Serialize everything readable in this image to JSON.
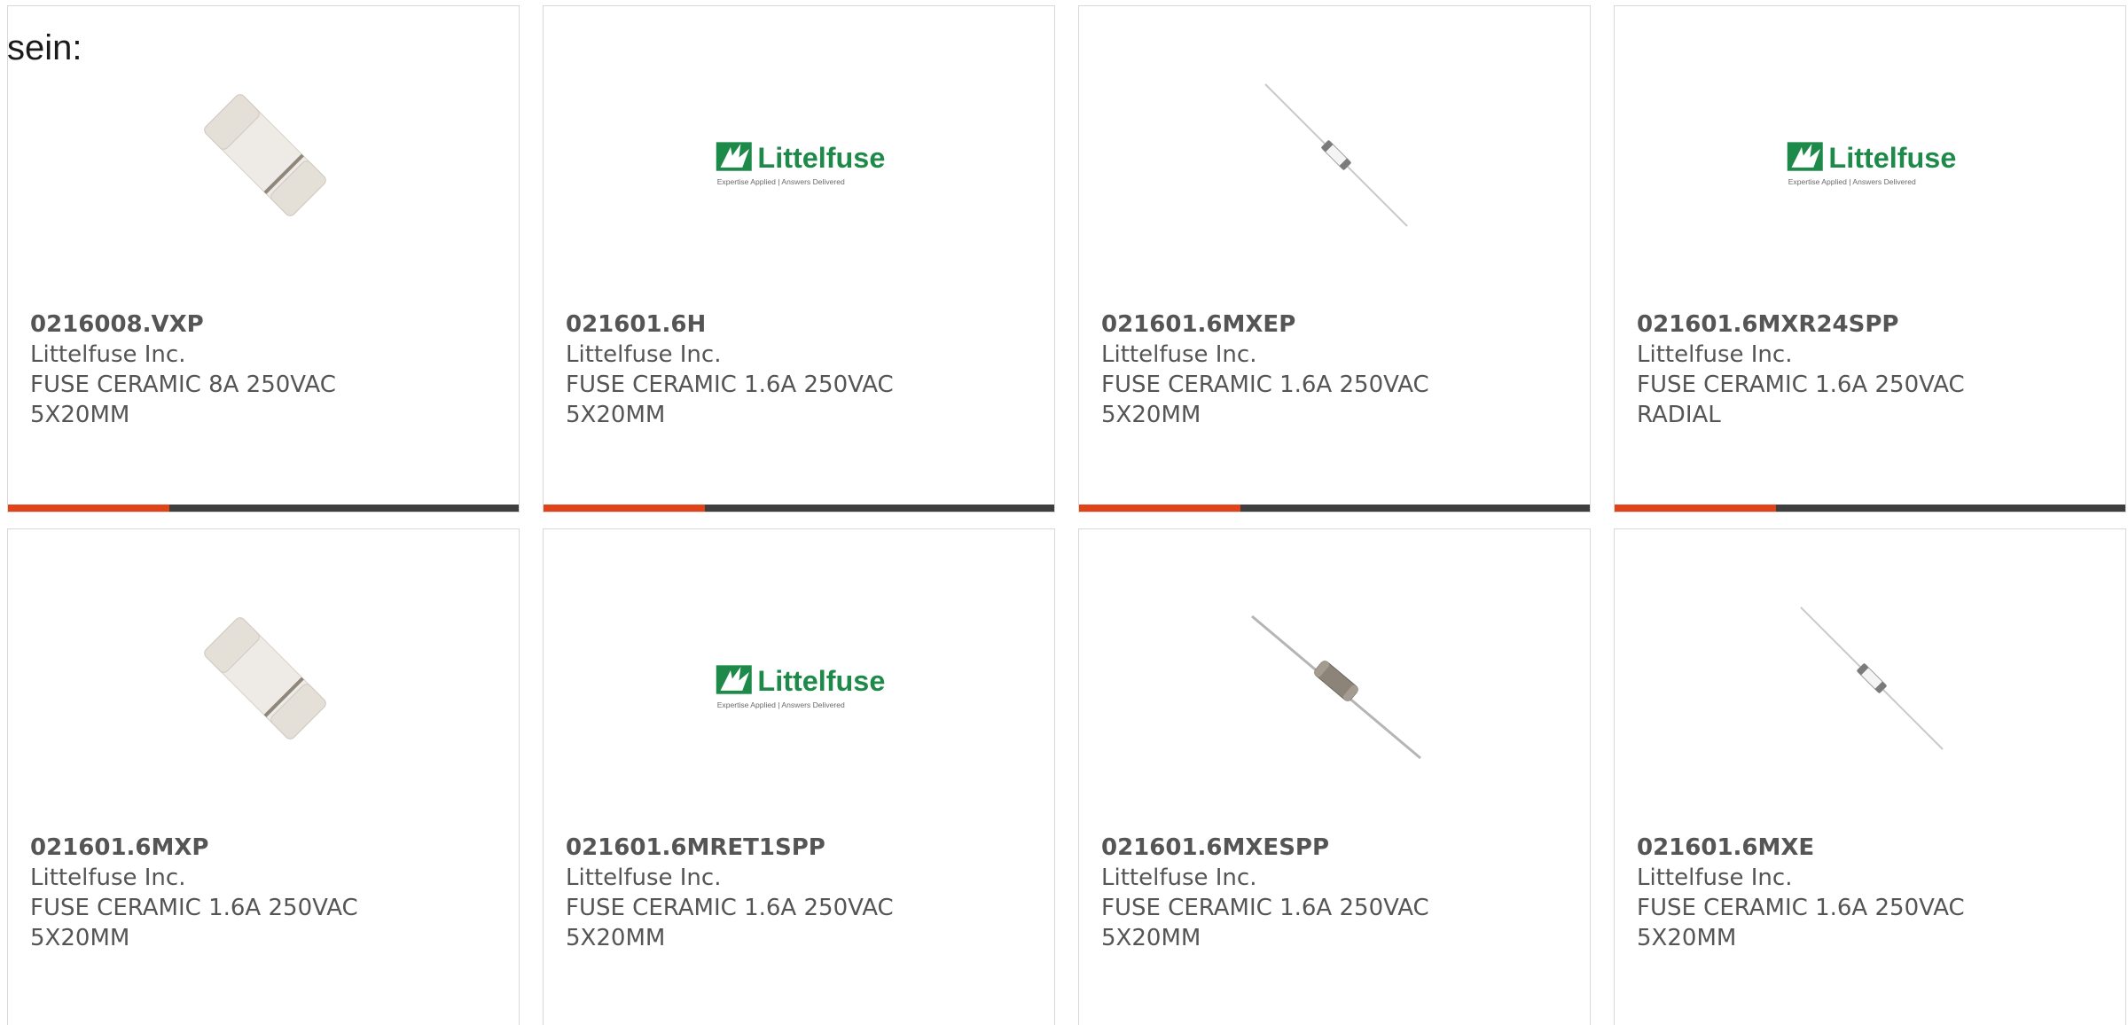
{
  "intro_text": "sein:",
  "colors": {
    "accent": "#e0431a",
    "bar_dark": "#3e3e3e",
    "logo_green": "#1e8a4a"
  },
  "brand_logo": {
    "name": "Littelfuse",
    "tagline": "Expertise Applied | Answers Delivered"
  },
  "products": [
    {
      "part_number": "0216008.VXP",
      "manufacturer": "Littelfuse Inc.",
      "description": "FUSE CERAMIC 8A 250VAC 5X20MM",
      "image": "cartridge-fuse-icon"
    },
    {
      "part_number": "021601.6H",
      "manufacturer": "Littelfuse Inc.",
      "description": "FUSE CERAMIC 1.6A 250VAC 5X20MM",
      "image": "littelfuse-logo"
    },
    {
      "part_number": "021601.6MXEP",
      "manufacturer": "Littelfuse Inc.",
      "description": "FUSE CERAMIC 1.6A 250VAC 5X20MM",
      "image": "axial-fuse-icon"
    },
    {
      "part_number": "021601.6MXR24SPP",
      "manufacturer": "Littelfuse Inc.",
      "description": "FUSE CERAMIC 1.6A 250VAC RADIAL",
      "image": "littelfuse-logo"
    },
    {
      "part_number": "021601.6MXP",
      "manufacturer": "Littelfuse Inc.",
      "description": "FUSE CERAMIC 1.6A 250VAC 5X20MM",
      "image": "cartridge-fuse-icon"
    },
    {
      "part_number": "021601.6MRET1SPP",
      "manufacturer": "Littelfuse Inc.",
      "description": "FUSE CERAMIC 1.6A 250VAC 5X20MM",
      "image": "littelfuse-logo"
    },
    {
      "part_number": "021601.6MXESPP",
      "manufacturer": "Littelfuse Inc.",
      "description": "FUSE CERAMIC 1.6A 250VAC 5X20MM",
      "image": "axial-fuse-dark-icon"
    },
    {
      "part_number": "021601.6MXE",
      "manufacturer": "Littelfuse Inc.",
      "description": "FUSE CERAMIC 1.6A 250VAC 5X20MM",
      "image": "axial-fuse-icon"
    }
  ]
}
